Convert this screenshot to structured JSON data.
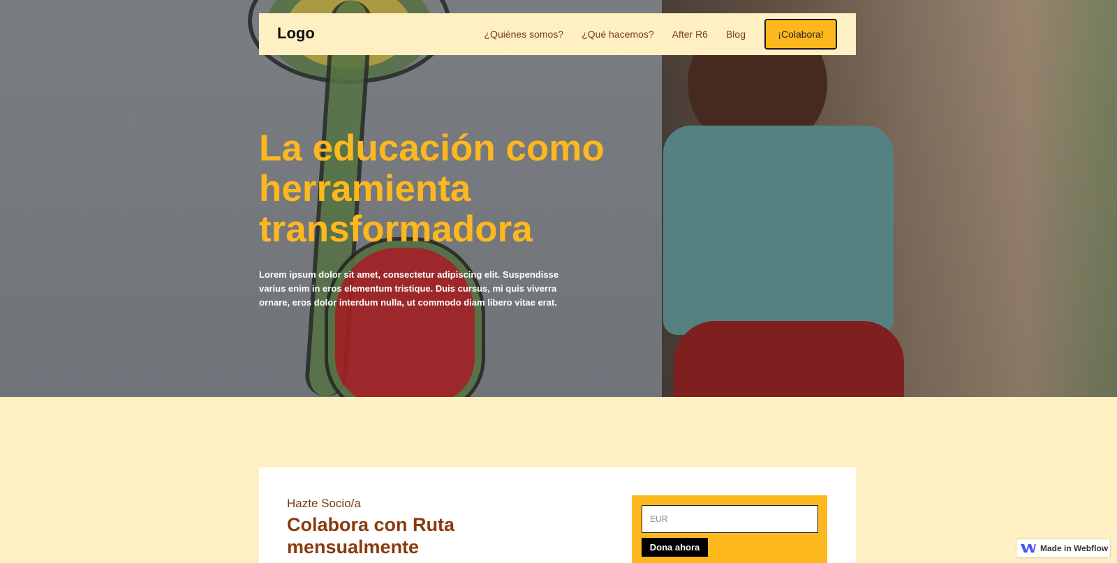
{
  "nav": {
    "logo": "Logo",
    "links": [
      "¿Quiénes somos?",
      "¿Qué hacemos?",
      "After R6",
      "Blog"
    ],
    "cta": "¡Colabora!"
  },
  "hero": {
    "title": "La educación como herramienta transformadora",
    "subtitle": "Lorem ipsum dolor sit amet, consectetur adipiscing elit. Suspendisse varius enim in eros elementum tristique. Duis cursus, mi quis viverra ornare, eros dolor interdum nulla, ut commodo diam libero vitae erat."
  },
  "donation": {
    "eyebrow": "Hazte Socio/a",
    "title": "Colabora con Ruta mensualmente",
    "amount_placeholder": "EUR",
    "amount_value": "",
    "button": "Dona ahora"
  },
  "badge": {
    "text": "Made in Webflow",
    "icon": "webflow-icon"
  },
  "colors": {
    "accent_yellow": "#fdb81e",
    "cream": "#fff0c4",
    "brown": "#8a3a0c"
  }
}
